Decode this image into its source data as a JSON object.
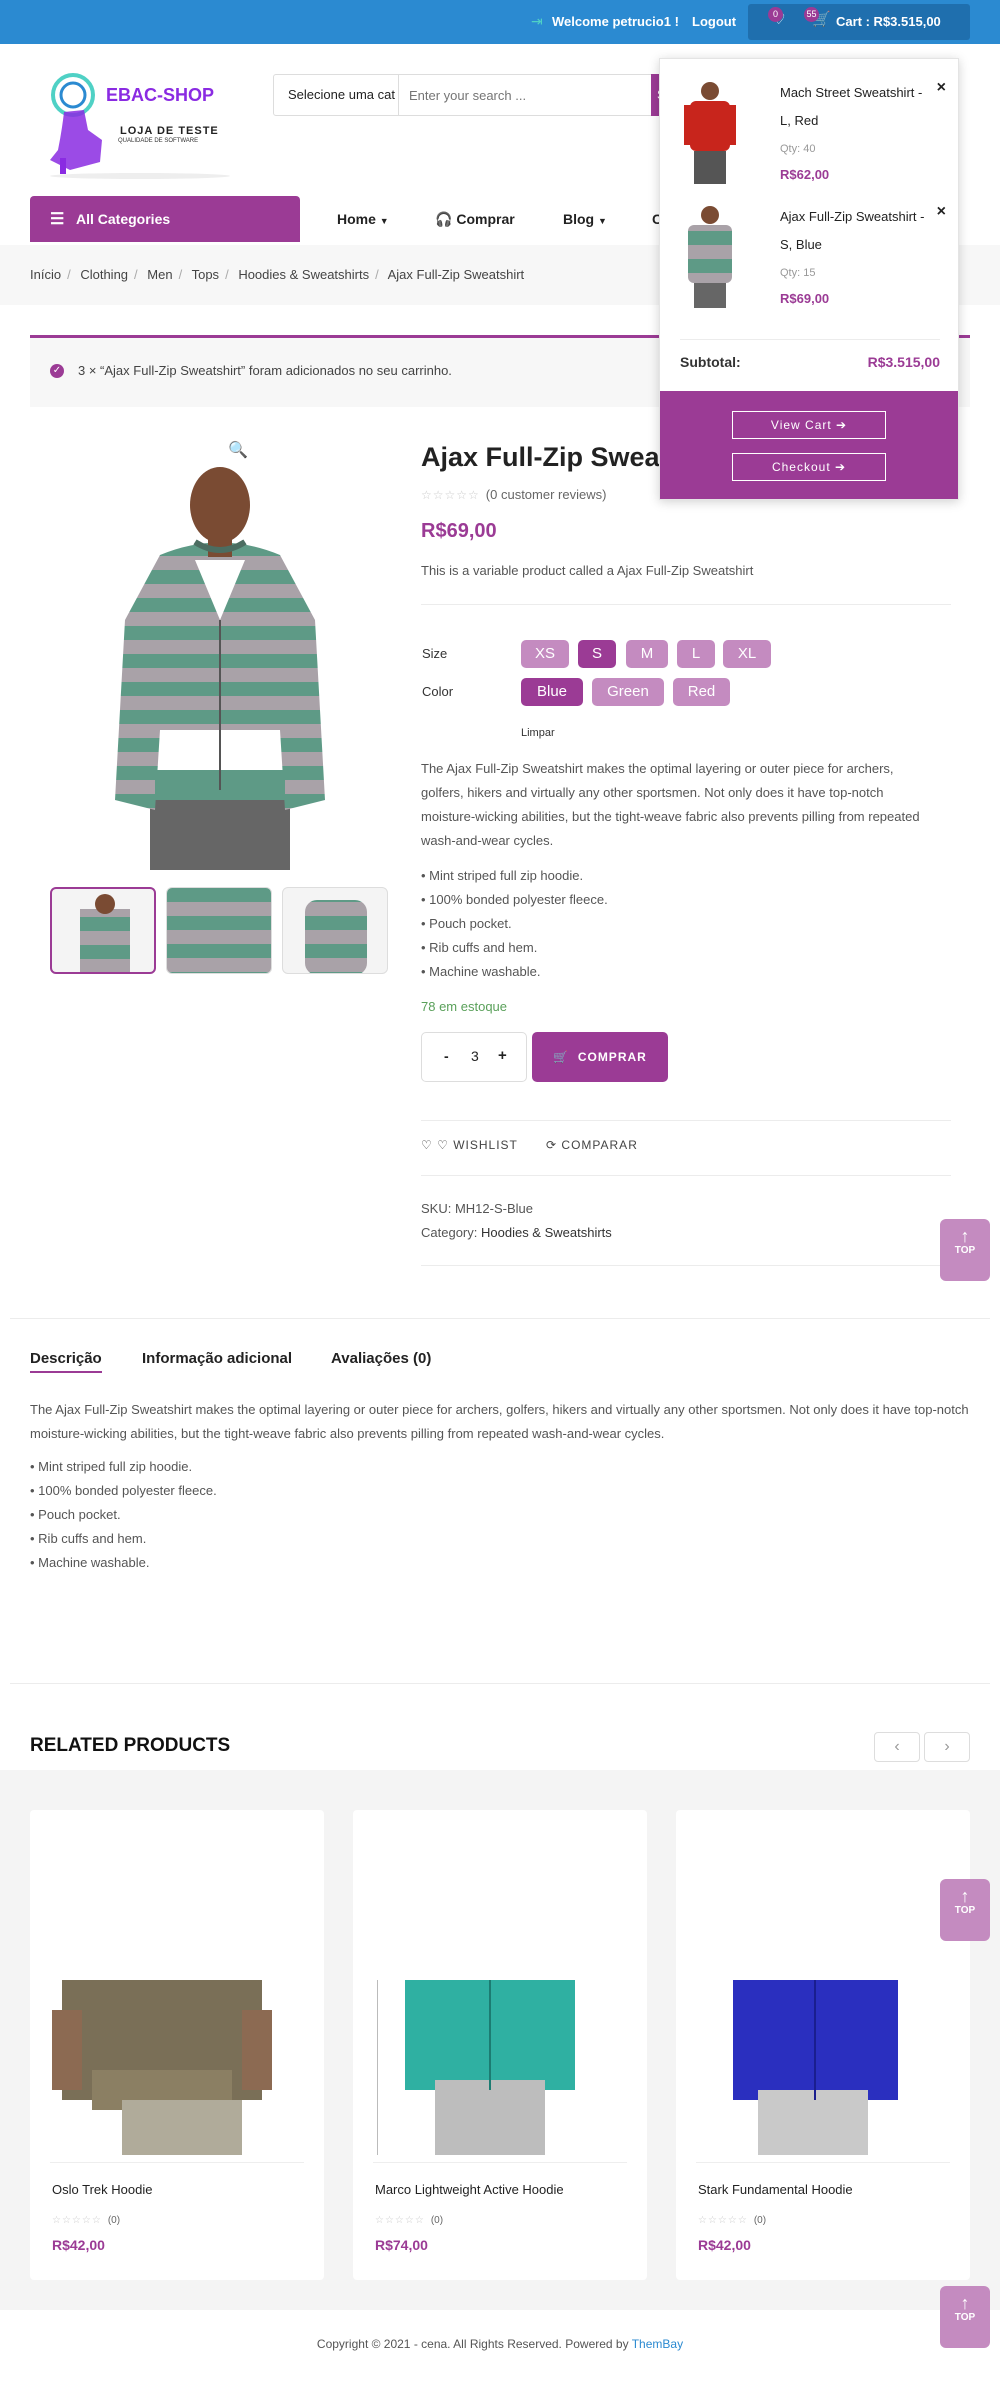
{
  "topbar": {
    "welcome": "Welcome petrucio1 !",
    "logout": "Logout",
    "wishlist_count": "0",
    "cart_count": "55",
    "cart_label": "Cart : R$3.515,00"
  },
  "logo": {
    "name": "EBAC-SHOP",
    "line1": "LOJA DE TESTE",
    "line2": "QUALIDADE DE SOFTWARE"
  },
  "search": {
    "category": "Selecione uma cat",
    "placeholder": "Enter your search ...",
    "button": "S"
  },
  "nav": {
    "all_categories": "All Categories",
    "items": [
      "Home",
      "Comprar",
      "Blog",
      "C"
    ]
  },
  "breadcrumb": [
    "Início",
    "Clothing",
    "Men",
    "Tops",
    "Hoodies & Sweatshirts",
    "Ajax Full-Zip Sweatshirt"
  ],
  "notice": "3 × “Ajax Full-Zip Sweatshirt” foram adicionados no seu carrinho.",
  "product": {
    "title": "Ajax Full-Zip Sweatshirt",
    "reviews": "(0 customer reviews)",
    "price": "R$69,00",
    "short_description": "This is a variable product called a Ajax Full-Zip Sweatshirt",
    "size_label": "Size",
    "sizes": [
      "XS",
      "S",
      "M",
      "L",
      "XL"
    ],
    "color_label": "Color",
    "colors": [
      "Blue",
      "Green",
      "Red"
    ],
    "clear": "Limpar",
    "description": "The Ajax Full-Zip Sweatshirt makes the optimal layering or outer piece for archers, golfers, hikers and virtually any other sportsmen. Not only does it have top-notch moisture-wicking abilities, but the tight-weave fabric also prevents pilling from repeated wash-and-wear cycles.",
    "features": [
      "• Mint striped full zip hoodie.",
      "• 100% bonded polyester fleece.",
      "• Pouch pocket.",
      "• Rib cuffs and hem.",
      "• Machine washable."
    ],
    "stock": "78 em estoque",
    "qty": "3",
    "qty_minus": "-",
    "qty_plus": "+",
    "buy": "COMPRAR",
    "wishlist": "WISHLIST",
    "compare": "COMPARAR",
    "sku": "SKU: MH12-S-Blue",
    "category_label": "Category:",
    "category": "Hoodies & Sweatshirts"
  },
  "tabs": [
    "Descrição",
    "Informação adicional",
    "Avaliações (0)"
  ],
  "related": {
    "heading": "RELATED PRODUCTS",
    "items": [
      {
        "name": "Oslo Trek Hoodie",
        "reviews": "(0)",
        "price": "R$42,00"
      },
      {
        "name": "Marco Lightweight Active Hoodie",
        "reviews": "(0)",
        "price": "R$74,00"
      },
      {
        "name": "Stark Fundamental Hoodie",
        "reviews": "(0)",
        "price": "R$42,00"
      }
    ]
  },
  "top_button": "TOP",
  "footer": {
    "text": "Copyright © 2021 - cena. All Rights Reserved. Powered by",
    "link": "ThemBay"
  },
  "minicart": {
    "items": [
      {
        "name": "Mach Street Sweatshirt - L, Red",
        "qty": "Qty: 40",
        "price": "R$62,00"
      },
      {
        "name": "Ajax Full-Zip Sweatshirt - S, Blue",
        "qty": "Qty: 15",
        "price": "R$69,00"
      }
    ],
    "remove": "×",
    "subtotal_label": "Subtotal:",
    "subtotal_value": "R$3.515,00",
    "view_cart": "View Cart ➔",
    "checkout": "Checkout ➔"
  },
  "colors": {
    "brand": "#9b3b95",
    "topbar": "#2b8ad1",
    "swatch": "#c48bc0"
  }
}
